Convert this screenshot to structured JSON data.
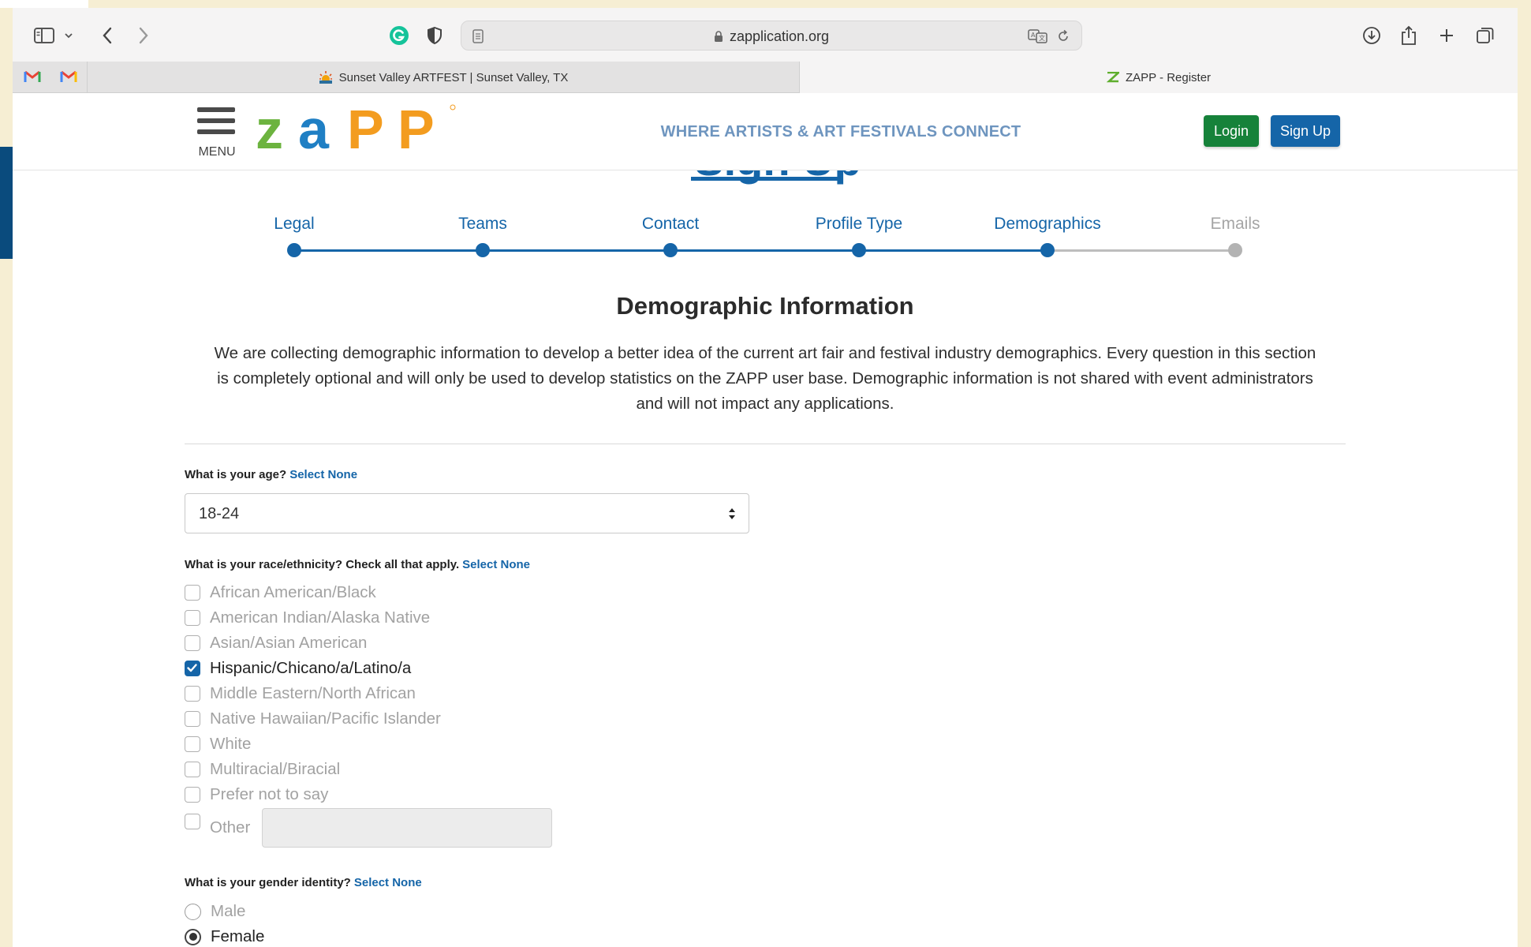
{
  "browser": {
    "address": "zapplication.org",
    "tabs": [
      {
        "label": "Sunset Valley ARTFEST | Sunset Valley, TX",
        "active": false
      },
      {
        "label": "ZAPP - Register",
        "active": true
      }
    ]
  },
  "header": {
    "menu_label": "MENU",
    "logo_text": "ZAPP",
    "tagline": "WHERE ARTISTS & ART FESTIVALS CONNECT",
    "login_label": "Login",
    "signup_label": "Sign Up"
  },
  "page": {
    "title": "Sign Up",
    "steps": [
      {
        "label": "Legal",
        "state": "done"
      },
      {
        "label": "Teams",
        "state": "done"
      },
      {
        "label": "Contact",
        "state": "done"
      },
      {
        "label": "Profile Type",
        "state": "done"
      },
      {
        "label": "Demographics",
        "state": "current"
      },
      {
        "label": "Emails",
        "state": "todo"
      }
    ],
    "section_title": "Demographic Information",
    "intro_line1": "We are collecting demographic information to develop a better idea of the current art fair and festival industry demographics. Every question in this section",
    "intro_line2": "is completely optional and will only be used to develop statistics on the ZAPP user base. Demographic information is not shared with event administrators",
    "intro_line3": "and will not impact any applications."
  },
  "age": {
    "question": "What is your age?",
    "select_none": "Select None",
    "selected": "18-24"
  },
  "race": {
    "question": "What is your race/ethnicity? Check all that apply.",
    "select_none": "Select None",
    "options": [
      {
        "label": "African American/Black",
        "checked": false
      },
      {
        "label": "American Indian/Alaska Native",
        "checked": false
      },
      {
        "label": "Asian/Asian American",
        "checked": false
      },
      {
        "label": "Hispanic/Chicano/a/Latino/a",
        "checked": true
      },
      {
        "label": "Middle Eastern/North African",
        "checked": false
      },
      {
        "label": "Native Hawaiian/Pacific Islander",
        "checked": false
      },
      {
        "label": "White",
        "checked": false
      },
      {
        "label": "Multiracial/Biracial",
        "checked": false
      },
      {
        "label": "Prefer not to say",
        "checked": false
      },
      {
        "label": "Other",
        "checked": false
      }
    ],
    "other_value": ""
  },
  "gender": {
    "question": "What is your gender identity?",
    "select_none": "Select None",
    "options": [
      {
        "label": "Male",
        "selected": false
      },
      {
        "label": "Female",
        "selected": true
      }
    ]
  },
  "colors": {
    "brand_blue": "#1565a8",
    "login_green": "#16823a",
    "tagline": "#6e95bf",
    "inactive": "#bdbdbd"
  }
}
